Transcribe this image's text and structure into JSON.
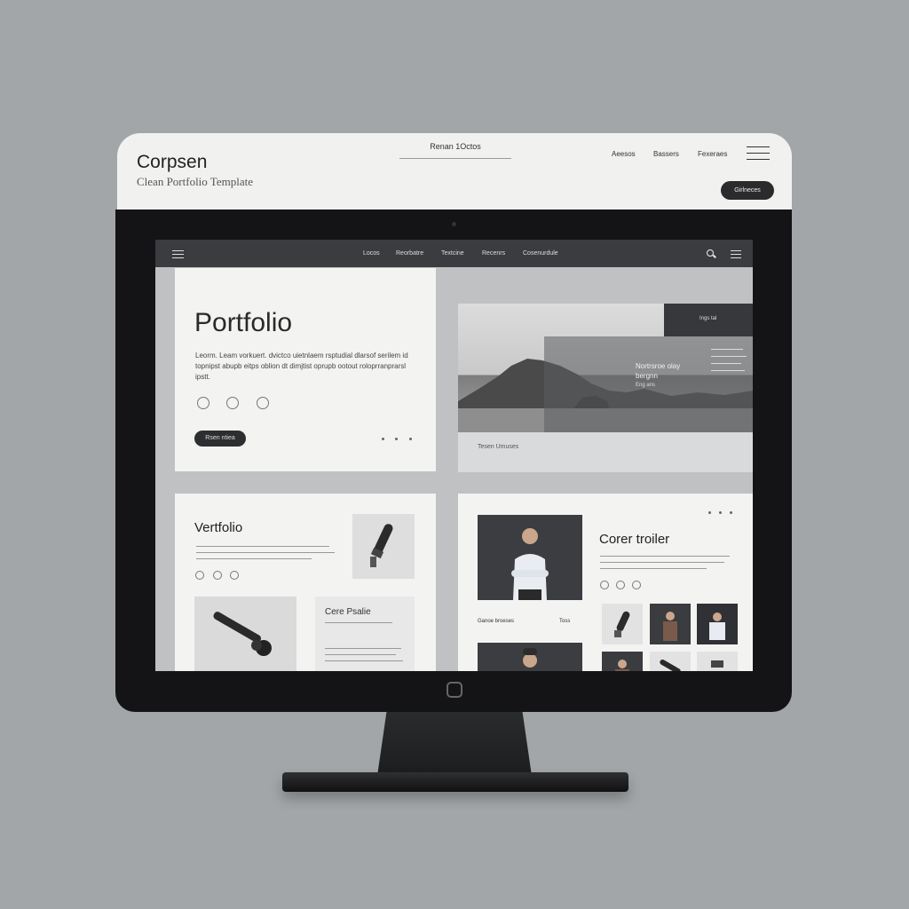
{
  "header": {
    "brand": "Corpsen",
    "tagline": "Clean Portfolio Template",
    "center_label": "Renan 1Octos",
    "nav": [
      "Aeesos",
      "Bassers",
      "Fexeraes"
    ],
    "pill_label": "Girlneces"
  },
  "screen": {
    "nav": [
      "Locos",
      "Reorbatre",
      "Textcine",
      "Recenrs",
      "Cosenurdule"
    ],
    "hero": {
      "title": "Portfolio",
      "body": "Leorm. Leam vorkuert. dvictco uietnlaem rsptudial dlarsof serilem id topnipst abupb eitps oblion dt dimjtist oprupb ootout roloprranprarsl ipstt.",
      "button": "Rsen ntiea"
    },
    "feature": {
      "tag": "Ings  tal",
      "overlay_title": "Nortrsroe olay bergnn",
      "overlay_sub": "Eng ans",
      "caption": "Tesen  Umuses"
    },
    "card_left": {
      "title": "Vertfolio",
      "sub_title": "Cere Psalie"
    },
    "card_right": {
      "title": "Corer troiler",
      "label_left": "Ganoe broeses",
      "label_right": "Toss"
    }
  }
}
